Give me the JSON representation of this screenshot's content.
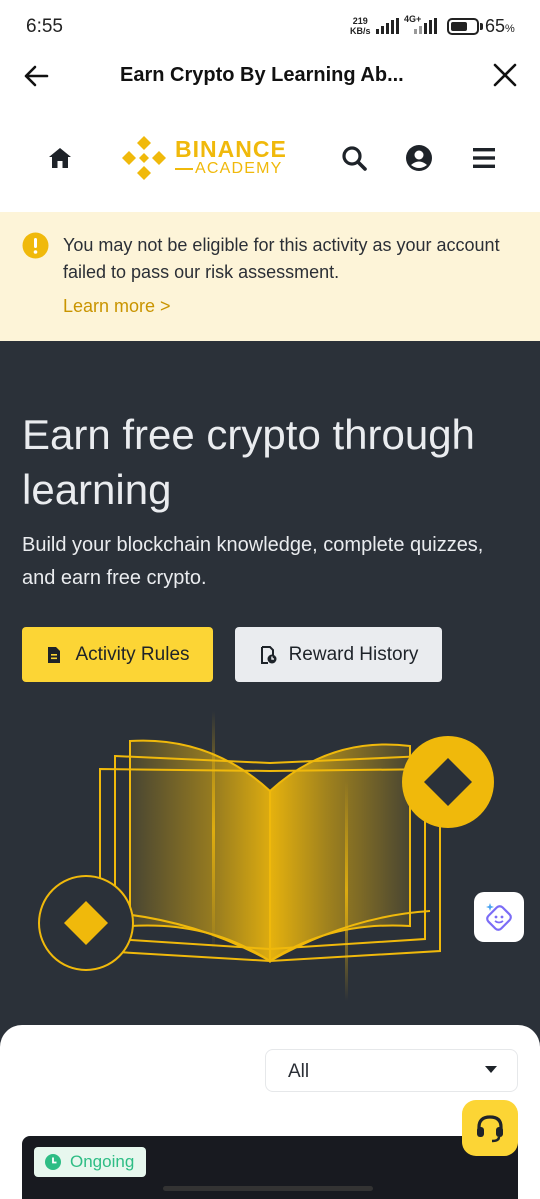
{
  "status_bar": {
    "time": "6:55",
    "net_speed_value": "219",
    "net_speed_unit": "KB/s",
    "network_type": "4G+",
    "battery_percent": "65",
    "battery_unit": "%",
    "battery_level": 0.65
  },
  "nav": {
    "title": "Earn Crypto By Learning Ab..."
  },
  "header": {
    "logo_text_top": "BINANCE",
    "logo_text_bottom": "ACADEMY",
    "icons": [
      "home-icon",
      "search-icon",
      "account-icon",
      "menu-icon"
    ]
  },
  "alert": {
    "message": "You may not be eligible for this activity as your account failed to pass our risk assessment.",
    "link": "Learn more >"
  },
  "hero": {
    "title": "Earn free crypto through learning",
    "subtitle": "Build your blockchain knowledge, complete quizzes, and earn free crypto.",
    "primary_button": "Activity Rules",
    "secondary_button": "Reward History"
  },
  "filter": {
    "selected": "All"
  },
  "activity": {
    "status": "Ongoing"
  },
  "colors": {
    "brand_yellow": "#f0b90b",
    "button_yellow": "#fcd535",
    "hero_bg": "#2b3139",
    "alert_bg": "#fdf4d8",
    "link_gold": "#c99400",
    "ongoing_green": "#2ebd85"
  }
}
